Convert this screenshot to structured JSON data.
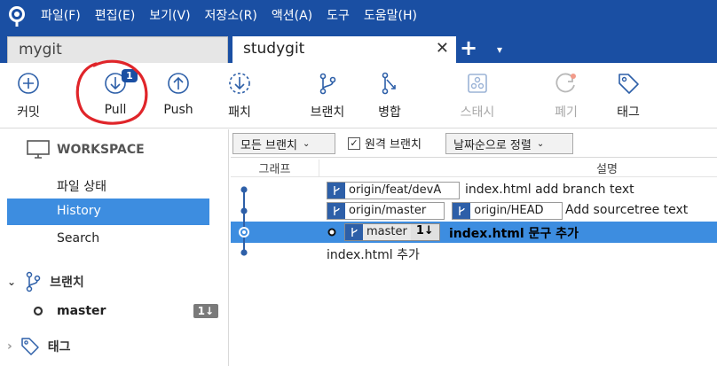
{
  "menu": [
    "파일(F)",
    "편집(E)",
    "보기(V)",
    "저장소(R)",
    "액션(A)",
    "도구",
    "도움말(H)"
  ],
  "tabs": {
    "inactive": "mygit",
    "active": "studygit",
    "close": "✕",
    "add": "+",
    "more": "▾"
  },
  "toolbar": {
    "commit": "커밋",
    "pull": "Pull",
    "pull_badge": "1",
    "push": "Push",
    "fetch": "패치",
    "branch": "브랜치",
    "merge": "병합",
    "stash": "스태시",
    "discard": "폐기",
    "tag": "태그"
  },
  "sidebar": {
    "workspace": "WORKSPACE",
    "items": [
      "파일 상태",
      "History",
      "Search"
    ],
    "active_index": 1,
    "branches_header": "브랜치",
    "branch_name": "master",
    "branch_count": "1↓",
    "tags_header": "태그"
  },
  "filters": {
    "branches": "모든 브랜치",
    "remote": "원격 브랜치",
    "remote_checked": true,
    "sort": "날짜순으로 정렬"
  },
  "columns": {
    "graph": "그래프",
    "description": "설명"
  },
  "commits": [
    {
      "tags": [
        "origin/feat/devA"
      ],
      "message": "index.html add branch text"
    },
    {
      "tags": [
        "origin/master",
        "origin/HEAD"
      ],
      "message": "Add sourcetree text"
    },
    {
      "tags": [
        "master"
      ],
      "tag_count": "1↓",
      "message": "index.html 문구 추가",
      "selected": true
    },
    {
      "tags": [],
      "message": "index.html 추가"
    }
  ],
  "colors": {
    "brand_blue": "#1a4fa3",
    "selection_blue": "#3d8de0",
    "annotation_red": "#e0252a"
  }
}
